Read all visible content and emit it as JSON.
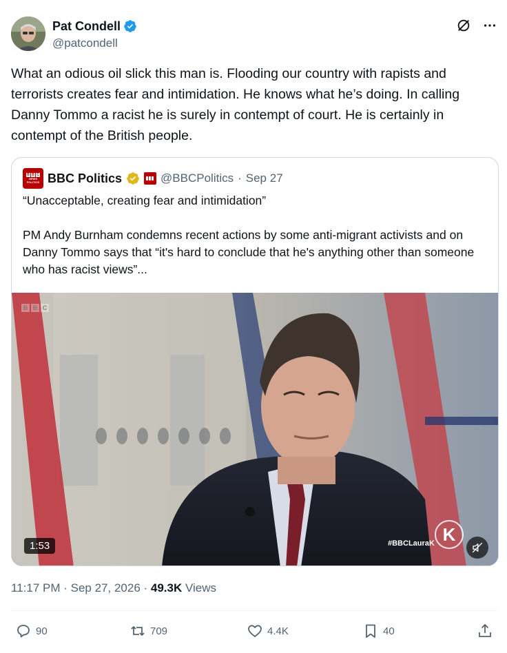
{
  "author": {
    "display_name": "Pat Condell",
    "handle": "@patcondell",
    "verified_icon": "verified-badge-icon"
  },
  "top_actions": {
    "grok_icon": "grok-icon",
    "more_icon": "more-icon"
  },
  "tweet": {
    "text": "What an odious oil slick this man is. Flooding our country with rapists and terrorists creates fear and intimidation. He knows what he’s doing. In calling Danny Tommo a racist he is surely in contempt of court. He is certainly in contempt of the British people."
  },
  "quote": {
    "name": "BBC Politics",
    "handle": "@BBCPolitics",
    "separator": "·",
    "date": "Sep 27",
    "text": "“Unacceptable, creating fear and intimidation”\n\nPM Andy Burnham condemns recent actions by some anti-migrant activists and on Danny Tommo says that “it's hard to conclude that he's anything other than someone who has racist views”...",
    "media": {
      "duration": "1:53",
      "hashtag": "#BBCLauraK",
      "logo_letter": "K",
      "watermark": [
        "B",
        "B",
        "C"
      ],
      "accent_color": "#b80000"
    }
  },
  "meta": {
    "time": "11:17 PM",
    "separator1": " · ",
    "date": "Sep 27, 2026",
    "separator2": " · ",
    "views_count": "49.3K",
    "views_label": " Views"
  },
  "actions": {
    "replies": "90",
    "reposts": "709",
    "likes": "4.4K",
    "bookmarks": "40"
  },
  "colors": {
    "text": "#0f1419",
    "secondary": "#536471",
    "verified_blue": "#1d9bf0",
    "gold": "#e2b719",
    "border": "#cfd9de"
  }
}
